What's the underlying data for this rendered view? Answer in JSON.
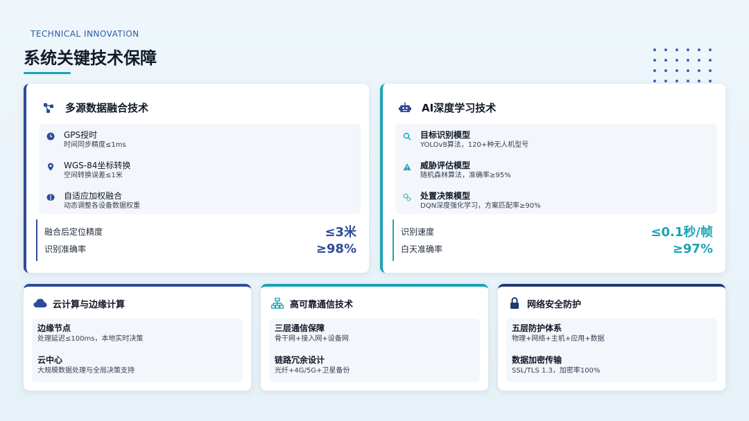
{
  "header": {
    "subtitle": "TECHNICAL INNOVATION",
    "title": "系统关键技术保障"
  },
  "colors": {
    "navy": "#2e4b9a",
    "teal": "#1aa3b5",
    "dark_navy": "#1e3a6e"
  },
  "left_card": {
    "title": "多源数据融合技术",
    "icon": "network-nodes-icon",
    "features": [
      {
        "title": "GPS授时",
        "desc": "时间同步精度≤1ms",
        "icon": "clock-icon"
      },
      {
        "title": "WGS-84坐标转换",
        "desc": "空间转换误差≤1米",
        "icon": "location-pin-icon"
      },
      {
        "title": "自适应加权融合",
        "desc": "动态调整各设备数据权重",
        "icon": "brain-icon"
      }
    ],
    "metrics": [
      {
        "label": "融合后定位精度",
        "value": "≤3米"
      },
      {
        "label": "识别准确率",
        "value": "≥98%"
      }
    ]
  },
  "right_card": {
    "title": "AI深度学习技术",
    "icon": "robot-icon",
    "features": [
      {
        "title": "目标识别模型",
        "desc": "YOLOv8算法，120+种无人机型号",
        "icon": "search-icon"
      },
      {
        "title": "威胁评估模型",
        "desc": "随机森林算法，准确率≥95%",
        "icon": "warning-icon"
      },
      {
        "title": "处置决策模型",
        "desc": "DQN深度强化学习，方案匹配率≥90%",
        "icon": "gears-icon"
      }
    ],
    "metrics": [
      {
        "label": "识别速度",
        "value": "≤0.1秒/帧"
      },
      {
        "label": "白天准确率",
        "value": "≥97%"
      }
    ]
  },
  "small_cards": [
    {
      "title": "云计算与边缘计算",
      "icon": "cloud-icon",
      "items": [
        {
          "title": "边缘节点",
          "desc": "处理延迟≤100ms，本地实时决策"
        },
        {
          "title": "云中心",
          "desc": "大规模数据处理与全局决策支持"
        }
      ]
    },
    {
      "title": "高可靠通信技术",
      "icon": "network-topology-icon",
      "items": [
        {
          "title": "三层通信保障",
          "desc": "骨干网+接入网+设备网"
        },
        {
          "title": "链路冗余设计",
          "desc": "光纤+4G/5G+卫星备份"
        }
      ]
    },
    {
      "title": "网络安全防护",
      "icon": "lock-icon",
      "items": [
        {
          "title": "五层防护体系",
          "desc": "物理+网络+主机+应用+数据"
        },
        {
          "title": "数据加密传输",
          "desc": "SSL/TLS 1.3，加密率100%"
        }
      ]
    }
  ]
}
